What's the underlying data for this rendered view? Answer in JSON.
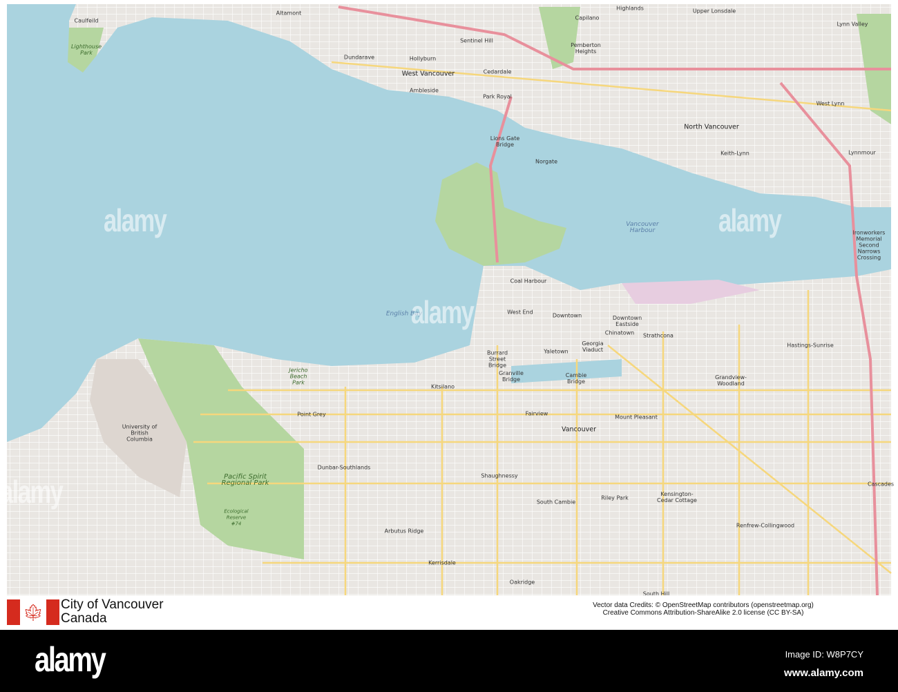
{
  "map": {
    "colors": {
      "water": "#aad3df",
      "land": "#f2efe9",
      "park": "#b5d6a0",
      "major_road": "#f6d77c",
      "highway": "#e8909c"
    },
    "labels": [
      "Caulfeild",
      "Lighthouse Park",
      "Altamont",
      "Dundarave",
      "Hollyburn",
      "West Vancouver",
      "Cedardale",
      "Ambleside",
      "Sentinel Hill",
      "Park Royal",
      "Capilano",
      "Highlands",
      "Upper Lonsdale",
      "Lynn Valley",
      "Pemberton Heights",
      "North Vancouver",
      "Keith-Lynn",
      "West Lynn",
      "Lynnmour",
      "Lions Gate Bridge",
      "Norgate",
      "Vancouver Harbour",
      "Ironworkers Memorial Second Narrows Crossing",
      "Coal Harbour",
      "West End",
      "Downtown",
      "Downtown Eastside",
      "Chinatown",
      "Strathcona",
      "Hastings-Sunrise",
      "Yaletown",
      "Georgia Viaduct",
      "Burrard Street Bridge",
      "Granville Bridge",
      "Cambie Bridge",
      "Kitsilano",
      "Grandview-Woodland",
      "Jericho Beach Park",
      "English Bay",
      "Point Grey",
      "Fairview",
      "Mount Pleasant",
      "Vancouver",
      "University of British Columbia",
      "Dunbar-Southlands",
      "Shaughnessy",
      "Pacific Spirit Regional Park",
      "Ecological Reserve #74",
      "South Cambie",
      "Riley Park",
      "Kensington-Cedar Cottage",
      "Arbutus Ridge",
      "Renfrew-Collingwood",
      "Cascades",
      "Kerrisdale",
      "Oakridge",
      "South Hill"
    ],
    "watermark": "alamy"
  },
  "caption": {
    "city": "City of Vancouver",
    "country": "Canada",
    "credits_line1": "Vector data Credits: © OpenStreetMap contributors (openstreetmap.org)",
    "credits_line2": "Creative Commons Attribution-ShareAlike 2.0 license (CC BY-SA)"
  },
  "footer": {
    "logo": "alamy",
    "image_id": "Image ID: W8P7CY",
    "url": "www.alamy.com"
  }
}
